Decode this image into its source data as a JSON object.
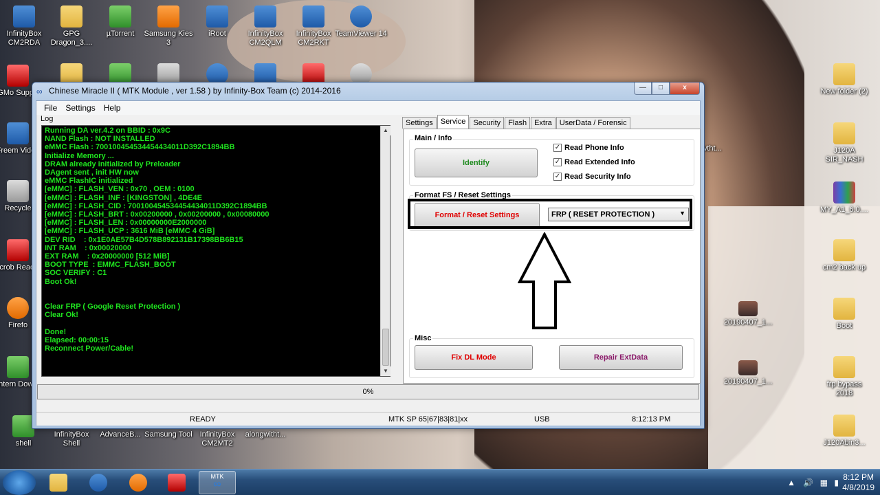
{
  "window": {
    "title": "Chinese Miracle II ( MTK Module , ver 1.58 ) by Infinity-Box Team (c) 2014-2016",
    "controls": {
      "minimize": "—",
      "maximize": "□",
      "close": "x"
    }
  },
  "menu": {
    "file": "File",
    "settings": "Settings",
    "help": "Help"
  },
  "log": {
    "label": "Log",
    "lines": [
      "Running DA ver.4.2 on BBID : 0x9C",
      "NAND Flash : NOT INSTALLED",
      "eMMC Flash : 700100454534454434011D392C1894BB",
      "Initialize Memory ...",
      "DRAM already initialized by Preloader",
      "DAgent sent , init HW now",
      "eMMC FlashIC initialized",
      "[eMMC] : FLASH_VEN : 0x70 , OEM : 0100",
      "[eMMC] : FLASH_INF : [KINGSTON] , 4DE4E",
      "[eMMC] : FLASH_CID : 700100454534454434011D392C1894BB",
      "[eMMC] : FLASH_BRT : 0x00200000 , 0x00200000 , 0x00080000",
      "[eMMC] : FLASH_LEN : 0x00000000E2000000",
      "[eMMC] : FLASH_UCP : 3616 MiB [eMMC 4 GiB]",
      "DEV RID    : 0x1E0AE57B4D578B892131B17398BB6B15",
      "INT RAM    : 0x00020000",
      "EXT RAM    : 0x20000000 [512 MiB]",
      "BOOT TYPE  : EMMC_FLASH_BOOT",
      "SOC VERIFY : C1",
      "Boot Ok!",
      "",
      "",
      "Clear FRP ( Google Reset Protection )",
      "Clear Ok!",
      "",
      "Done!",
      "Elapsed: 00:00:15",
      "Reconnect Power/Cable!"
    ]
  },
  "tabs": [
    "Settings",
    "Service",
    "Security",
    "Flash",
    "Extra",
    "UserData / Forensic"
  ],
  "service": {
    "main_info_title": "Main / Info",
    "identify_label": "Identify",
    "checks": {
      "read_phone_info": "Read Phone Info",
      "read_extended_info": "Read Extended Info",
      "read_security_info": "Read Security Info"
    },
    "format_title": "Format FS / Reset Settings",
    "format_button": "Format / Reset Settings",
    "format_option": "FRP ( RESET PROTECTION )",
    "misc_title": "Misc",
    "fix_dl_label": "Fix DL Mode",
    "repair_ext_label": "Repair ExtData"
  },
  "progress": {
    "text": "0%",
    "percent": 0
  },
  "status": {
    "state": "READY",
    "chip": "MTK SP 65|67|83|81|xx",
    "port": "USB",
    "time": "8:12:13 PM"
  },
  "desktop_icons_left": [
    {
      "label": "InfinityBox CM2RDA",
      "icon": "app-icon"
    },
    {
      "label": "GPG Dragon_3....",
      "icon": "folder-icon"
    },
    {
      "label": "µTorrent",
      "icon": "utorrent-icon"
    },
    {
      "label": "Samsung Kies 3",
      "icon": "kies-icon"
    },
    {
      "label": "iRoot",
      "icon": "iroot-icon"
    },
    {
      "label": "InfinityBox CM2QLM",
      "icon": "app-icon"
    },
    {
      "label": "InfinityBox CM2RKT",
      "icon": "app-icon"
    },
    {
      "label": "TeamViewer 14",
      "icon": "teamviewer-icon"
    }
  ],
  "desktop_icons_col": [
    {
      "label": "LGMo Support",
      "icon": "app-icon"
    },
    {
      "label": "Freem Video",
      "icon": "app-icon"
    },
    {
      "label": "Recycle",
      "icon": "recycle-bin-icon"
    },
    {
      "label": "Acrob Reader",
      "icon": "acrobat-icon"
    },
    {
      "label": "Firefo",
      "icon": "firefox-icon"
    },
    {
      "label": "Intern Downl",
      "icon": "app-icon"
    },
    {
      "label": "shell",
      "icon": "app-icon"
    }
  ],
  "desktop_icons_bottom": [
    {
      "label": "InfinityBox Shell"
    },
    {
      "label": "AdvanceB..."
    },
    {
      "label": "Samsung Tool"
    },
    {
      "label": "InfinityBox CM2MT2"
    },
    {
      "label": "alongwitht..."
    }
  ],
  "desktop_icons_right": [
    {
      "label": "New folder (2)",
      "icon": "folder-icon"
    },
    {
      "label": "J120A SIR_NASH",
      "icon": "folder-icon"
    },
    {
      "label": "MY_A1_6.0....",
      "icon": "winrar-icon"
    },
    {
      "label": "cm2 back up",
      "icon": "folder-icon"
    },
    {
      "label": "Boot",
      "icon": "folder-icon"
    },
    {
      "label": "frp bypass 2018",
      "icon": "folder-icon"
    },
    {
      "label": "J120Abin3...",
      "icon": "folder-icon"
    }
  ],
  "desktop_icons_mid": [
    {
      "label": "20190407_1..."
    },
    {
      "label": "20190407_1..."
    },
    {
      "label": "wtht..."
    }
  ],
  "taskbar": {
    "clock_time": "8:12 PM",
    "clock_date": "4/8/2019",
    "mtk_label": "MTK"
  }
}
